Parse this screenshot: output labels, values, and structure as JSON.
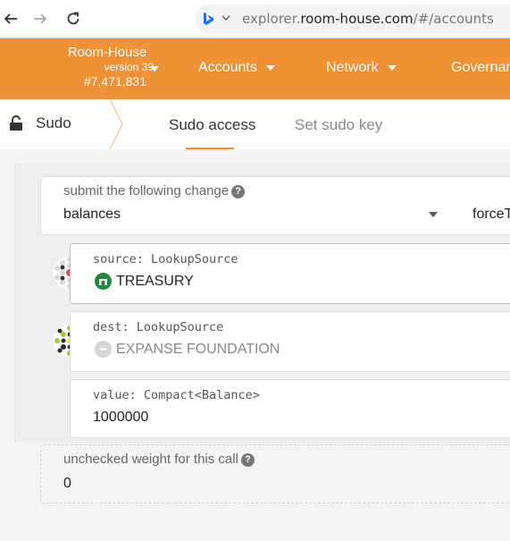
{
  "browser": {
    "url_prefix": "explorer.",
    "url_host": "room-house.com",
    "url_path": "/#/accounts"
  },
  "header": {
    "brand_name": "Room-House",
    "version": "version 39",
    "block_number": "#7,471,831",
    "menu": [
      "Accounts",
      "Network",
      "Governan"
    ],
    "color": "#f19135"
  },
  "tabs": {
    "section": "Sudo",
    "items": [
      "Sudo access",
      "Set sudo key"
    ]
  },
  "extrinsic": {
    "label": "submit the following change",
    "module": "balances",
    "method": "forceT"
  },
  "params": {
    "source": {
      "label": "source: LookupSource",
      "account": "TREASURY"
    },
    "dest": {
      "label": "dest: LookupSource",
      "account": "EXPANSE FOUNDATION"
    },
    "value": {
      "label": "value: Compact<Balance>",
      "amount": "1000000"
    }
  },
  "weight": {
    "label": "unchecked weight for this call",
    "value": "0"
  }
}
